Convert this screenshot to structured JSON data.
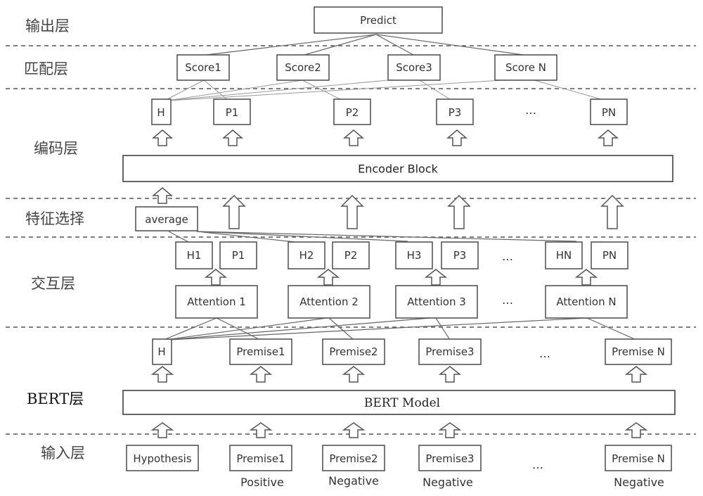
{
  "layers": {
    "output": "输出层",
    "matching": "匹配层",
    "encoding": "编码层",
    "feature_selection": "特征选择",
    "interaction": "交互层",
    "bert": "BERT层",
    "input": "输入层"
  },
  "output_layer": {
    "predict": "Predict"
  },
  "matching_layer": {
    "scores": [
      "Score1",
      "Score2",
      "Score3",
      "Score N"
    ]
  },
  "encoding_layer": {
    "nodes": [
      "H",
      "P1",
      "P2",
      "P3",
      "PN"
    ],
    "ellipsis": "…",
    "block": "Encoder Block"
  },
  "feature_selection_layer": {
    "average": "average"
  },
  "interaction_layer": {
    "pairs": [
      {
        "h": "H1",
        "p": "P1"
      },
      {
        "h": "H2",
        "p": "P2"
      },
      {
        "h": "H3",
        "p": "P3"
      },
      {
        "h": "HN",
        "p": "PN"
      }
    ],
    "attention": [
      "Attention 1",
      "Attention 2",
      "Attention 3",
      "Attention N"
    ],
    "ellipsis": "…"
  },
  "bert_outputs": {
    "nodes": [
      "H",
      "Premise1",
      "Premise2",
      "Premise3",
      "Premise N"
    ],
    "ellipsis": "…"
  },
  "bert_layer": {
    "block": "BERT Model"
  },
  "input_layer": {
    "nodes": [
      "Hypothesis",
      "Premise1",
      "Premise2",
      "Premise3",
      "Premise N"
    ],
    "labels": [
      "",
      "Positive",
      "Negative",
      "Negative",
      "Negative"
    ],
    "ellipsis": "…"
  }
}
